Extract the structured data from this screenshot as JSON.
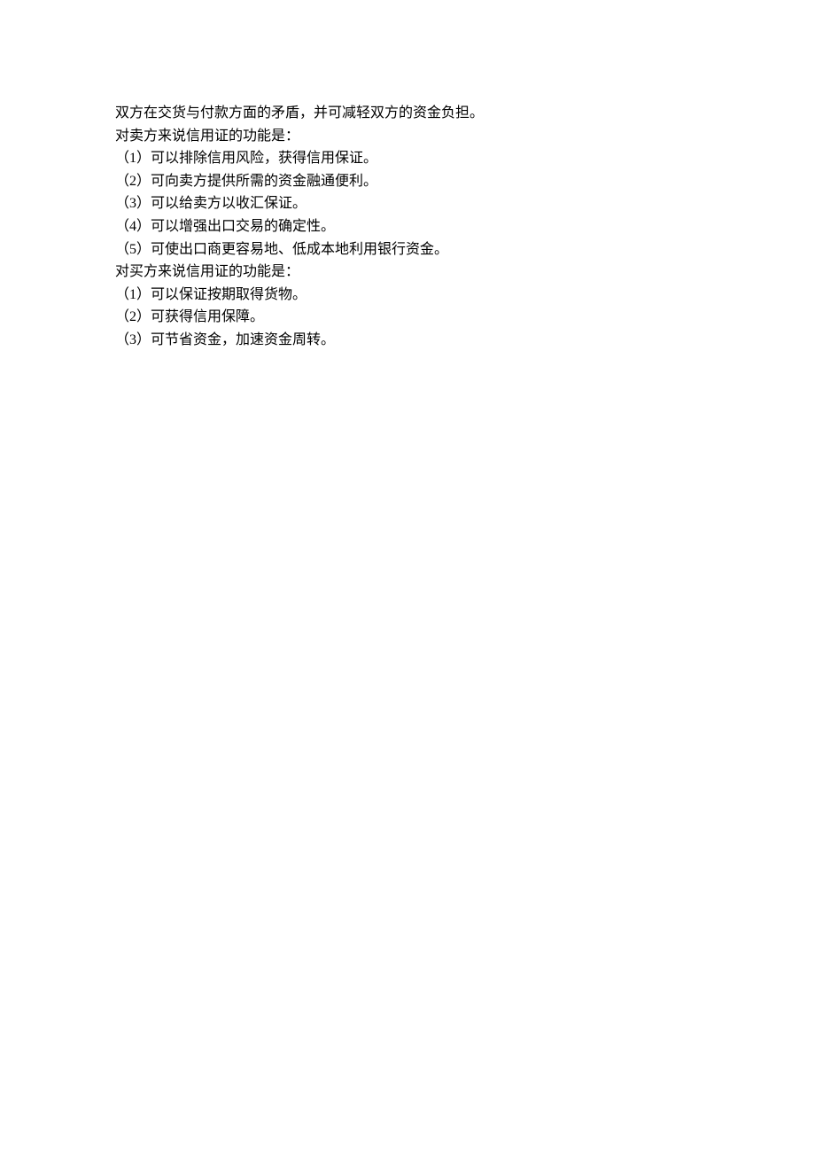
{
  "lines": {
    "intro": "双方在交货与付款方面的矛盾，并可减轻双方的资金负担。",
    "seller_heading": "对卖方来说信用证的功能是：",
    "seller_1": "（1）可以排除信用风险，获得信用保证。",
    "seller_2": "（2）可向卖方提供所需的资金融通便利。",
    "seller_3": "（3）可以给卖方以收汇保证。",
    "seller_4": "（4）可以增强出口交易的确定性。",
    "seller_5": "（5）可使出口商更容易地、低成本地利用银行资金。",
    "buyer_heading": "对买方来说信用证的功能是：",
    "buyer_1": "（1）可以保证按期取得货物。",
    "buyer_2": "（2）可获得信用保障。",
    "buyer_3": "（3）可节省资金，加速资金周转。"
  }
}
